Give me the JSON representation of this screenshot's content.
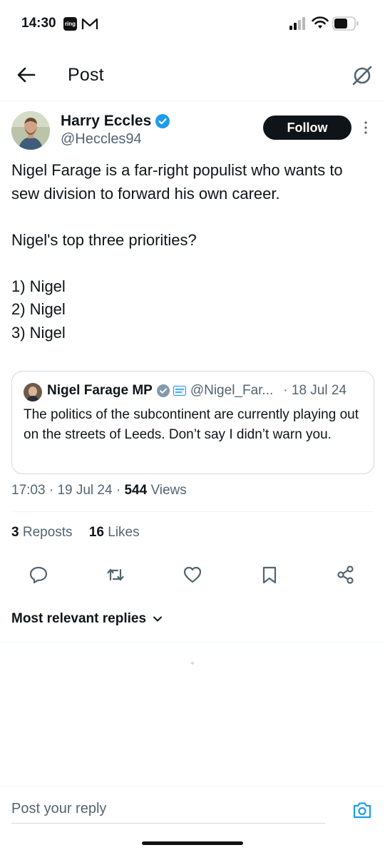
{
  "status_bar": {
    "time": "14:30",
    "ring_label": "ring",
    "icons": [
      "ring-app-icon",
      "mail-icon",
      "cell-signal-icon",
      "wifi-icon",
      "battery-icon"
    ]
  },
  "header": {
    "title": "Post",
    "icons": [
      "back-arrow-icon",
      "grok-icon"
    ]
  },
  "post": {
    "author_name": "Harry Eccles",
    "author_handle": "@Heccles94",
    "follow_label": "Follow",
    "text": "Nigel Farage is a far-right populist who wants to sew division to forward his own career.\n\nNigel's top three priorities?\n\n1) Nigel\n2) Nigel\n3) Nigel",
    "time": "17:03",
    "date": "19 Jul 24",
    "views_count": "544",
    "views_label": "Views",
    "reposts_count": "3",
    "reposts_label": "Reposts",
    "likes_count": "16",
    "likes_label": "Likes"
  },
  "quote": {
    "author_name": "Nigel Farage MP",
    "author_handle": "@Nigel_Far...",
    "date": "· 18 Jul 24",
    "text": "The politics of the subcontinent are currently playing out on the streets of Leeds. Don’t say I didn’t warn you."
  },
  "replies": {
    "sort_label": "Most relevant replies"
  },
  "reply_bar": {
    "placeholder": "Post your reply"
  },
  "colors": {
    "text": "#0f1419",
    "secondary": "#536471",
    "verified": "#1d9bf0",
    "accent": "#1d9bf0",
    "border": "#eff3f4"
  }
}
